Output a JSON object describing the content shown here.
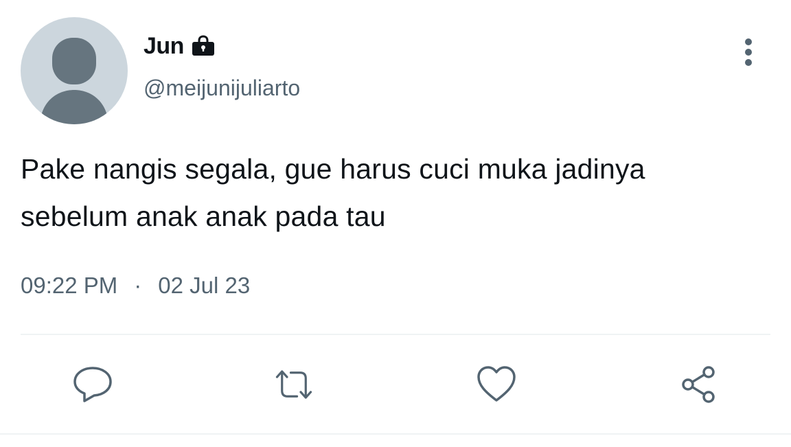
{
  "user": {
    "display_name": "Jun",
    "handle": "@meijunijuliarto",
    "protected_icon": "lock-icon",
    "avatar_icon": "default-avatar-icon"
  },
  "tweet": {
    "text_line_1": "Pake nangis segala, gue harus cuci muka jadinya",
    "text_line_2": "sebelum anak anak pada tau",
    "time": "09:22 PM",
    "separator": "·",
    "date": "02 Jul 23"
  },
  "actions": {
    "more": "more-vertical-icon",
    "reply": "reply-icon",
    "retweet": "retweet-icon",
    "like": "heart-icon",
    "share": "share-icon"
  },
  "colors": {
    "text_primary": "#0f1419",
    "text_secondary": "#536471",
    "avatar_bg": "#ccd6dd",
    "avatar_fg": "#66757f",
    "divider": "#eff3f4"
  }
}
